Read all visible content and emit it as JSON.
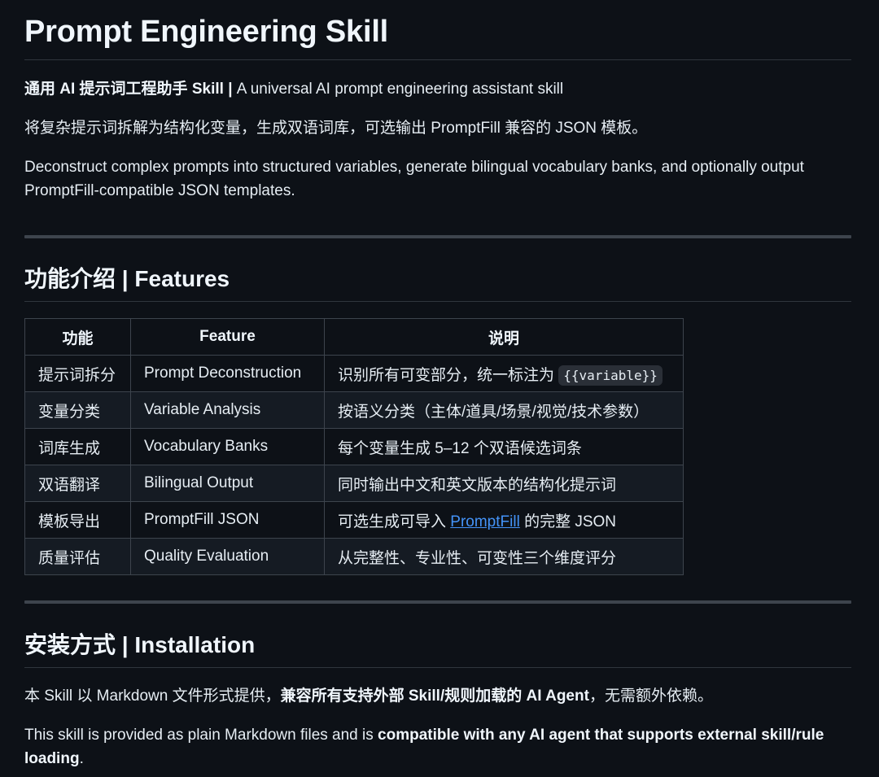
{
  "title": "Prompt Engineering Skill",
  "intro": {
    "bold_cn": "通用 AI 提示词工程助手 Skill",
    "separator": " | ",
    "en": "A universal AI prompt engineering assistant skill"
  },
  "desc_cn": "将复杂提示词拆解为结构化变量，生成双语词库，可选输出 PromptFill 兼容的 JSON 模板。",
  "desc_en": "Deconstruct complex prompts into structured variables, generate bilingual vocabulary banks, and optionally output PromptFill-compatible JSON templates.",
  "features": {
    "heading": "功能介绍 | Features",
    "headers": [
      "功能",
      "Feature",
      "说明"
    ],
    "rows": [
      {
        "cn": "提示词拆分",
        "en": "Prompt Deconstruction",
        "desc": "识别所有可变部分，统一标注为 ",
        "code": "{{variable}}"
      },
      {
        "cn": "变量分类",
        "en": "Variable Analysis",
        "desc": "按语义分类（主体/道具/场景/视觉/技术参数）"
      },
      {
        "cn": "词库生成",
        "en": "Vocabulary Banks",
        "desc": "每个变量生成 5–12 个双语候选词条"
      },
      {
        "cn": "双语翻译",
        "en": "Bilingual Output",
        "desc": "同时输出中文和英文版本的结构化提示词"
      },
      {
        "cn": "模板导出",
        "en": "PromptFill JSON",
        "desc_before": "可选生成可导入 ",
        "link": "PromptFill",
        "desc_after": " 的完整 JSON"
      },
      {
        "cn": "质量评估",
        "en": "Quality Evaluation",
        "desc": "从完整性、专业性、可变性三个维度评分"
      }
    ]
  },
  "installation": {
    "heading": "安装方式 | Installation",
    "cn_before": "本 Skill 以 Markdown 文件形式提供，",
    "cn_bold": "兼容所有支持外部 Skill/规则加载的 AI Agent",
    "cn_after": "，无需额外依赖。",
    "en_before": "This skill is provided as plain Markdown files and is ",
    "en_bold": "compatible with any AI agent that supports external skill/rule loading",
    "en_after": "."
  },
  "colors": {
    "background": "#0d1117",
    "text": "#e6edf3",
    "link": "#4493f8",
    "border": "#3d444d"
  }
}
